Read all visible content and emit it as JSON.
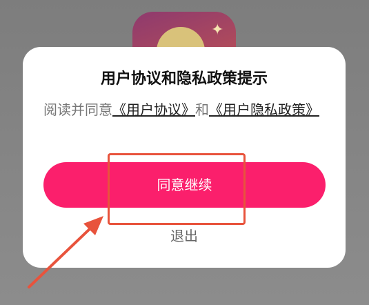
{
  "dialog": {
    "title": "用户协议和隐私政策提示",
    "body_prefix": "阅读并同意",
    "user_agreement_link": "《用户协议》",
    "connector": "和",
    "privacy_policy_link": "《用户隐私政策》",
    "agree_button": "同意继续",
    "exit_button": "退出"
  },
  "colors": {
    "primary": "#fb1f6c",
    "annotation": "#e8533c"
  }
}
